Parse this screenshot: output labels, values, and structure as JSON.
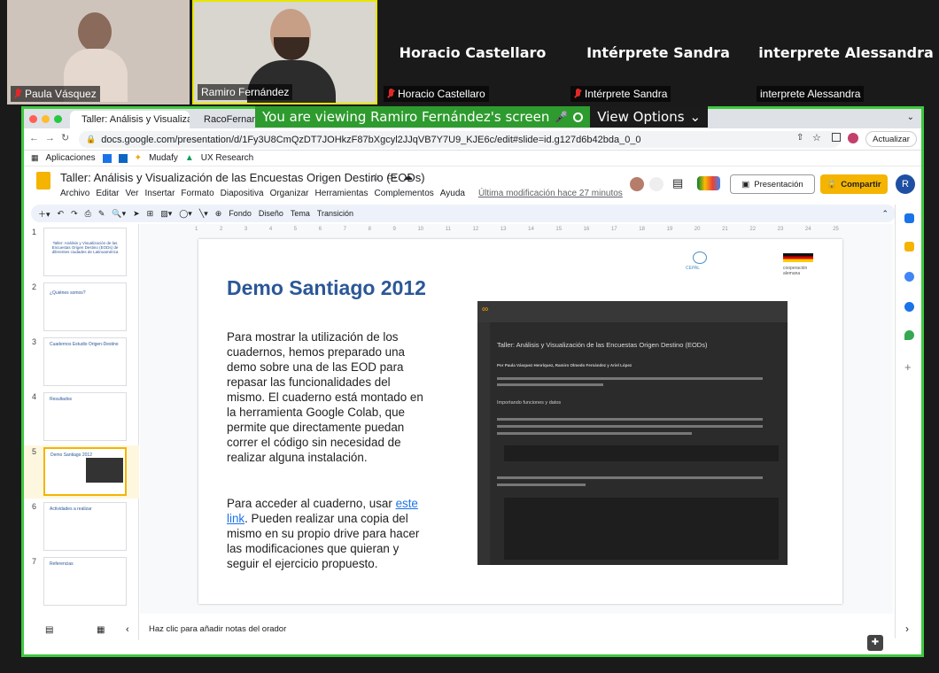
{
  "participants": [
    {
      "name": "Paula Vásquez",
      "muted": true
    },
    {
      "name": "Ramiro Fernández",
      "muted": false
    },
    {
      "name": "Horacio Castellaro",
      "muted": true
    },
    {
      "name": "Intérprete Sandra",
      "muted": true
    },
    {
      "name": "interprete Alessandra",
      "muted": false
    }
  ],
  "banner": {
    "message": "You are viewing Ramiro Fernández's screen",
    "options": "View Options"
  },
  "browser": {
    "tabs": [
      "Taller: Análisis y Visualizació",
      "RacoFernandez"
    ],
    "url": "docs.google.com/presentation/d/1Fy3U8CmQzDT7JOHkzF87bXgcyl2JJqVB7Y7U9_KJE6c/edit#slide=id.g127d6b42bda_0_0",
    "update_button": "Actualizar",
    "bookmarks": [
      "Aplicaciones",
      "Mudafy",
      "UX Research"
    ]
  },
  "docs": {
    "title": "Taller: Análisis y Visualización de las Encuestas Origen Destino (EODs)",
    "menu": [
      "Archivo",
      "Editar",
      "Ver",
      "Insertar",
      "Formato",
      "Diapositiva",
      "Organizar",
      "Herramientas",
      "Complementos",
      "Ayuda"
    ],
    "last_edit": "Última modificación hace 27 minutos",
    "present_button": "Presentación",
    "share_button": "Compartir",
    "avatar_letter": "R",
    "toolbar": [
      "Fondo",
      "Diseño",
      "Tema",
      "Transición"
    ]
  },
  "filmstrip": {
    "slides": [
      {
        "num": "1",
        "text": "Taller: Análisis y Visualización de las Encuestas Origen Destino (EODs) de diferentes ciudades de Latinoamérica"
      },
      {
        "num": "2",
        "text": "¿Quiénes somos?"
      },
      {
        "num": "3",
        "text": "Cuadernos Estudio Origen-Destino"
      },
      {
        "num": "4",
        "text": "Resultados"
      },
      {
        "num": "5",
        "text": "Demo Santiago 2012"
      },
      {
        "num": "6",
        "text": "Actividades a realizar"
      },
      {
        "num": "7",
        "text": "Referencias"
      }
    ],
    "selected_index": 5
  },
  "ruler_ticks": [
    "1",
    "2",
    "3",
    "4",
    "5",
    "6",
    "7",
    "8",
    "9",
    "10",
    "11",
    "12",
    "13",
    "14",
    "15",
    "16",
    "17",
    "18",
    "19",
    "20",
    "21",
    "22",
    "23",
    "24",
    "25"
  ],
  "slide": {
    "title": "Demo Santiago 2012",
    "paragraph1": "Para mostrar la utilización de los cuadernos, hemos preparado una demo sobre una de las EOD para repasar las funcionalidades del mismo. El cuaderno está montado en la herramienta Google Colab, que permite que directamente puedan correr el código sin necesidad de realizar alguna instalación.",
    "p2_before": "Para acceder al cuaderno, usar ",
    "p2_link": "este link",
    "p2_after": ". Pueden realizar una copia del mismo en su propio drive para hacer las modificaciones que quieran y seguir el ejercicio propuesto.",
    "colab_title": "Taller: Análisis y Visualización de las Encuestas Origen Destino (EODs)",
    "colab_authors": "Por Paula Vásquez Henríquez, Ramiro Olmedo Fernández y Ariel López",
    "colab_section": "Importando funciones y datos",
    "cepal_label": "CEPAL",
    "coop_label": "cooperación alemana"
  },
  "notes_placeholder": "Haz clic para añadir notas del orador"
}
